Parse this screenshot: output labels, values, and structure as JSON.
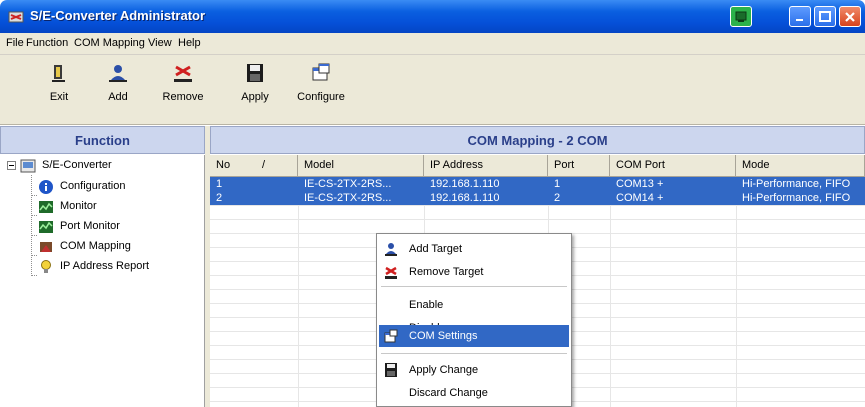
{
  "window": {
    "title": "S/E-Converter Administrator"
  },
  "menu": [
    "File",
    "Function",
    "COM Mapping",
    "View",
    "Help"
  ],
  "toolbar": {
    "exit": "Exit",
    "add": "Add",
    "remove": "Remove",
    "apply": "Apply",
    "configure": "Configure"
  },
  "left_panel": {
    "header": "Function",
    "root": "S/E-Converter",
    "items": [
      "Configuration",
      "Monitor",
      "Port Monitor",
      "COM Mapping",
      "IP Address Report"
    ]
  },
  "right_panel": {
    "header": "COM Mapping - 2 COM",
    "columns": [
      "No",
      "Model",
      "IP Address",
      "Port",
      "COM Port",
      "Mode"
    ],
    "sort_indicator": "/",
    "rows": [
      {
        "no": "1",
        "model": "IE-CS-2TX-2RS...",
        "ip": "192.168.1.110",
        "port": "1",
        "com": "COM13 +",
        "mode": "Hi-Performance, FIFO"
      },
      {
        "no": "2",
        "model": "IE-CS-2TX-2RS...",
        "ip": "192.168.1.110",
        "port": "2",
        "com": "COM14 +",
        "mode": "Hi-Performance, FIFO"
      }
    ]
  },
  "context_menu": {
    "add_target": "Add Target",
    "remove_target": "Remove Target",
    "enable": "Enable",
    "disable": "Disable",
    "com_settings": "COM Settings",
    "apply_change": "Apply Change",
    "discard_change": "Discard Change"
  },
  "colors": {
    "selection": "#3168c5",
    "panel_header": "#ccd6ee",
    "titlebar": "#0550d8"
  }
}
